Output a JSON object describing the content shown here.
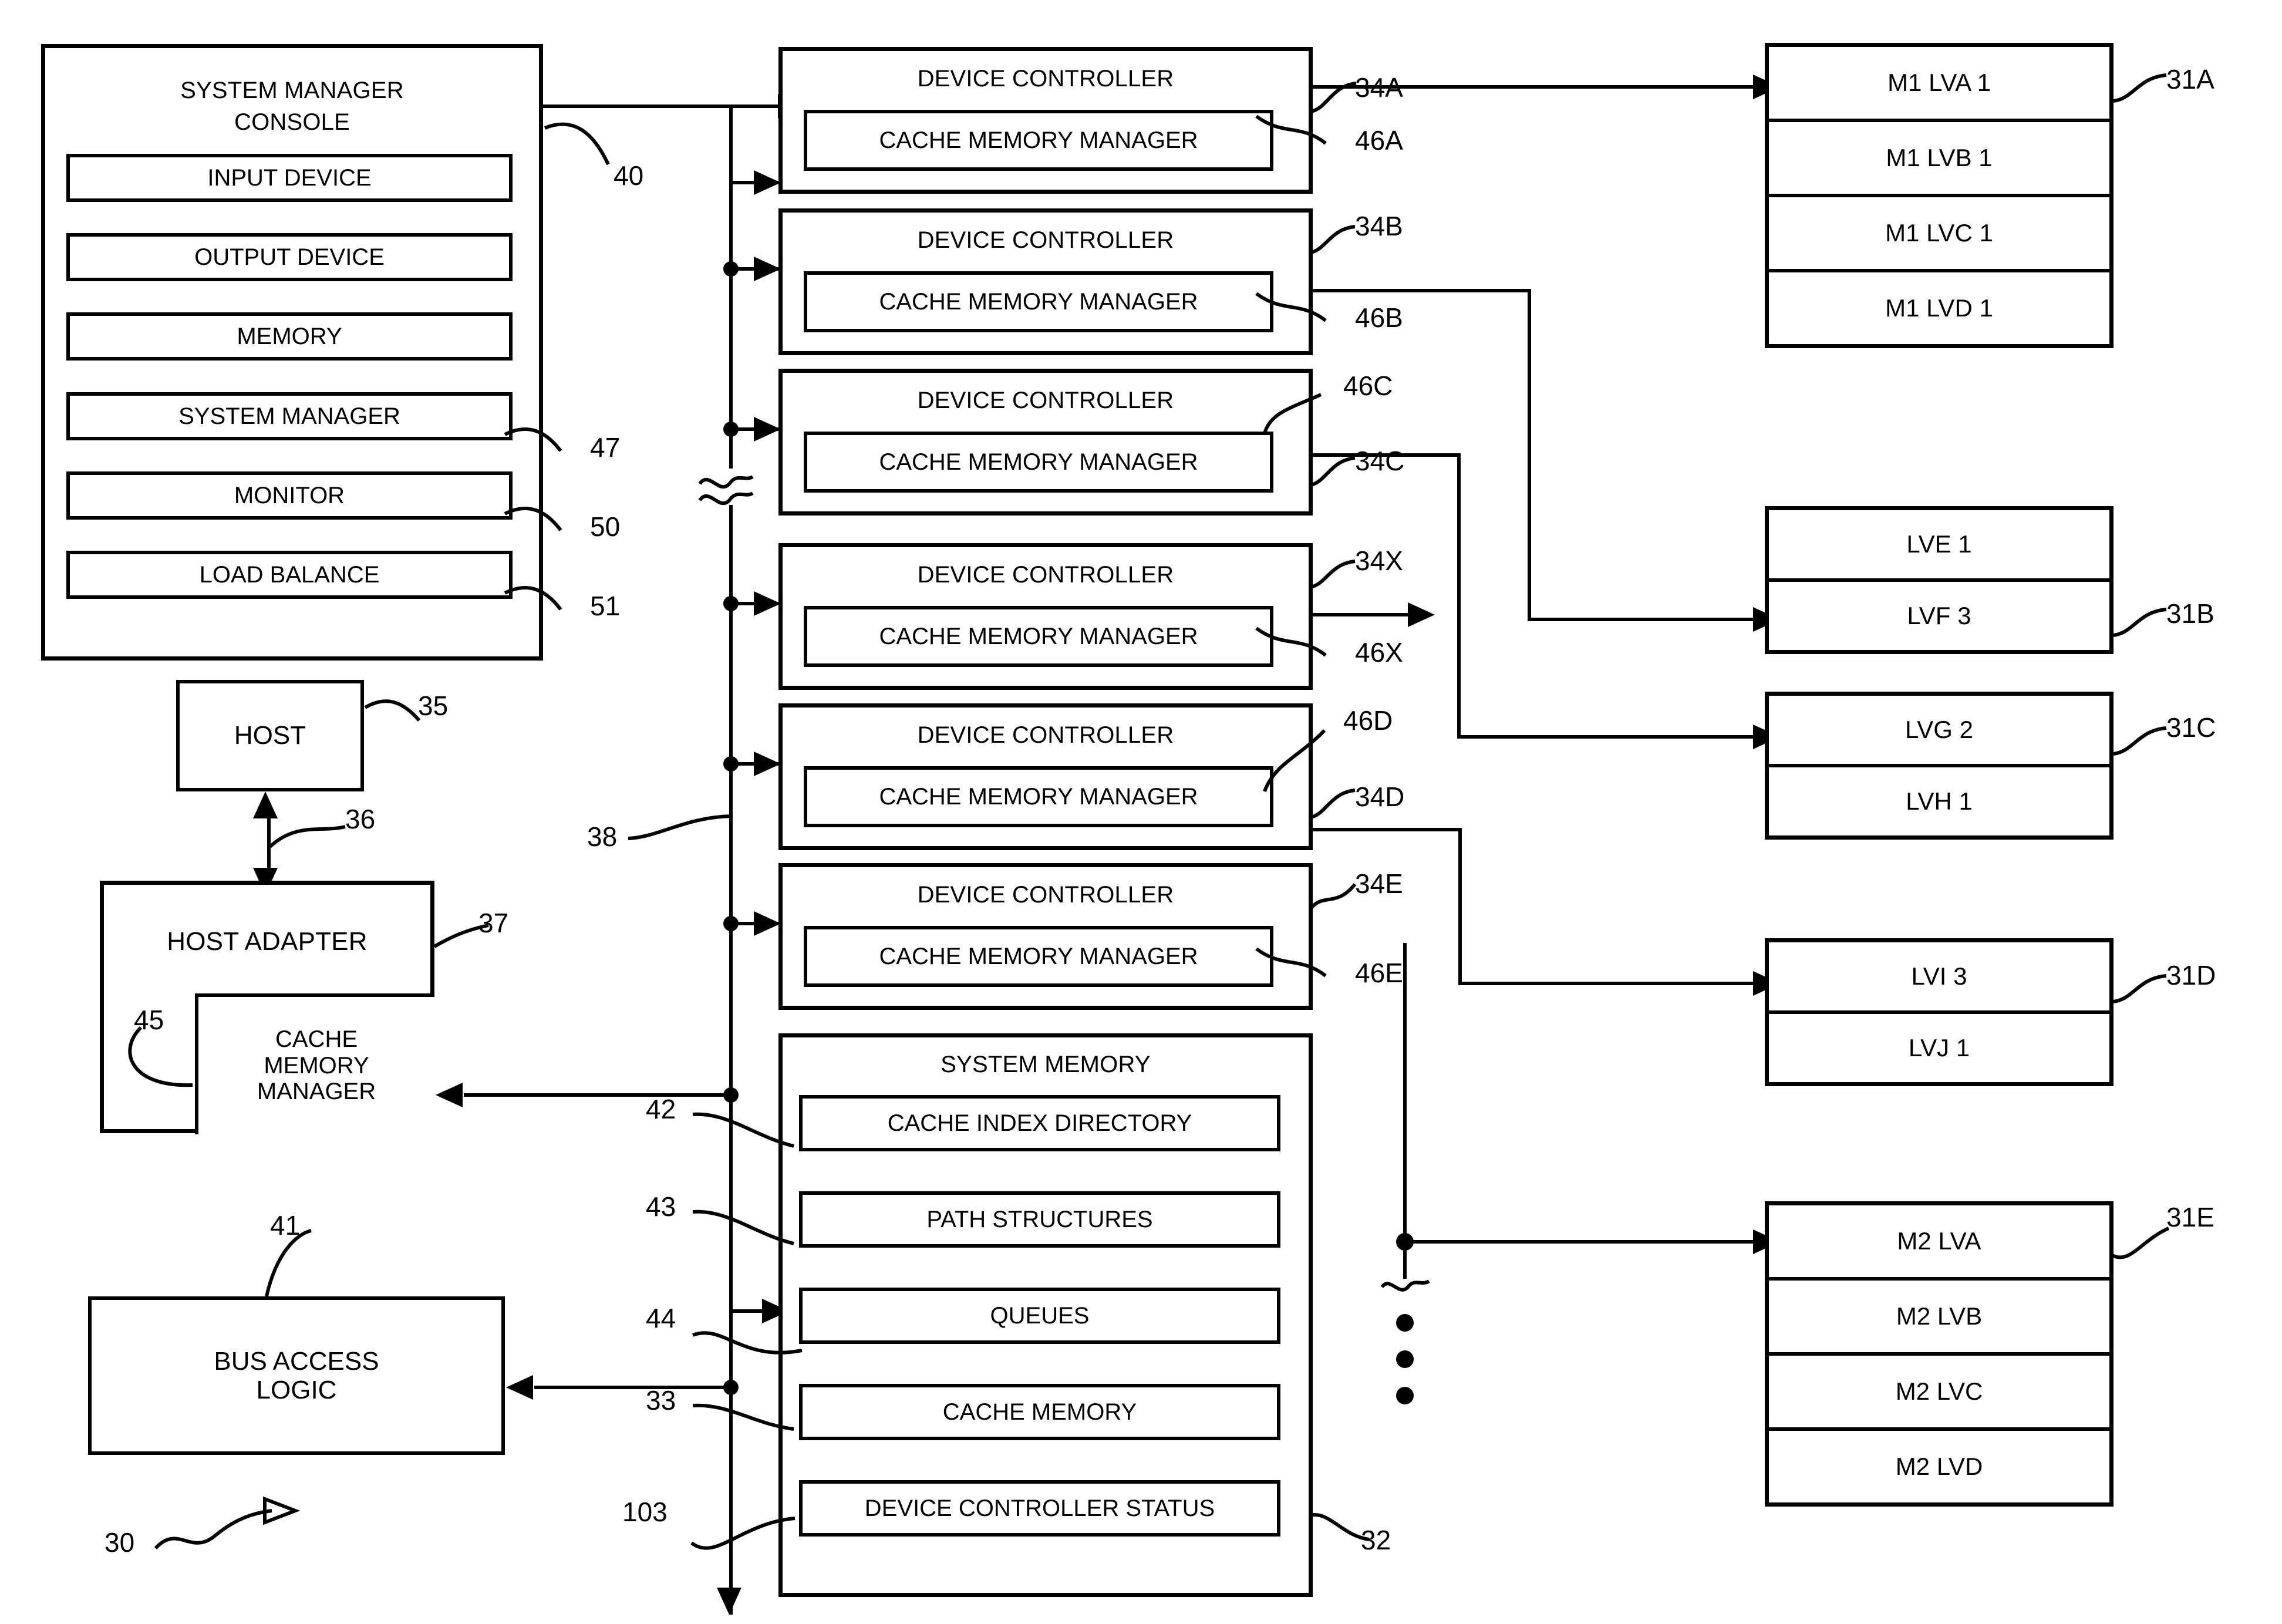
{
  "figure": {
    "label": "30",
    "bus_label": "38"
  },
  "console": {
    "title_line1": "SYSTEM MANAGER",
    "title_line2": "CONSOLE",
    "ref": "40",
    "items": [
      {
        "label": "INPUT DEVICE",
        "ref": ""
      },
      {
        "label": "OUTPUT DEVICE",
        "ref": ""
      },
      {
        "label": "MEMORY",
        "ref": ""
      },
      {
        "label": "SYSTEM MANAGER",
        "ref": "47"
      },
      {
        "label": "MONITOR",
        "ref": "50"
      },
      {
        "label": "LOAD BALANCE",
        "ref": "51"
      }
    ]
  },
  "host": {
    "label": "HOST",
    "ref": "35",
    "link_ref": "36"
  },
  "host_adapter": {
    "label": "HOST ADAPTER",
    "ref": "37",
    "cache_manager_line1": "CACHE",
    "cache_manager_line2": "MEMORY",
    "cache_manager_line3": "MANAGER",
    "cache_manager_ref": "45"
  },
  "bus_access_logic": {
    "line1": "BUS ACCESS",
    "line2": "LOGIC",
    "ref": "41"
  },
  "device_controllers": [
    {
      "title": "DEVICE CONTROLLER",
      "inner": "CACHE MEMORY MANAGER",
      "ref_ctrl": "34A",
      "ref_cmm": "46A"
    },
    {
      "title": "DEVICE CONTROLLER",
      "inner": "CACHE MEMORY MANAGER",
      "ref_ctrl": "34B",
      "ref_cmm": "46B"
    },
    {
      "title": "DEVICE CONTROLLER",
      "inner": "CACHE MEMORY MANAGER",
      "ref_ctrl": "34C",
      "ref_cmm": "46C"
    },
    {
      "title": "DEVICE CONTROLLER",
      "inner": "CACHE MEMORY MANAGER",
      "ref_ctrl": "34X",
      "ref_cmm": "46X"
    },
    {
      "title": "DEVICE CONTROLLER",
      "inner": "CACHE MEMORY MANAGER",
      "ref_ctrl": "34D",
      "ref_cmm": "46D"
    },
    {
      "title": "DEVICE CONTROLLER",
      "inner": "CACHE MEMORY MANAGER",
      "ref_ctrl": "34E",
      "ref_cmm": "46E"
    }
  ],
  "system_memory": {
    "title": "SYSTEM  MEMORY",
    "ref": "32",
    "items": [
      {
        "label": "CACHE INDEX DIRECTORY",
        "ref": "42"
      },
      {
        "label": "PATH STRUCTURES",
        "ref": "43"
      },
      {
        "label": "QUEUES",
        "ref": "44"
      },
      {
        "label": "CACHE MEMORY",
        "ref": "33"
      },
      {
        "label": "DEVICE CONTROLLER STATUS",
        "ref": "103"
      }
    ]
  },
  "volume_groups": [
    {
      "ref": "31A",
      "cells": [
        "M1 LVA 1",
        "M1 LVB 1",
        "M1 LVC 1",
        "M1 LVD 1"
      ]
    },
    {
      "ref": "31B",
      "cells": [
        "LVE 1",
        "LVF 3"
      ]
    },
    {
      "ref": "31C",
      "cells": [
        "LVG 2",
        "LVH 1"
      ]
    },
    {
      "ref": "31D",
      "cells": [
        "LVI 3",
        "LVJ 1"
      ]
    },
    {
      "ref": "31E",
      "cells": [
        "M2 LVA",
        "M2 LVB",
        "M2 LVC",
        "M2 LVD"
      ]
    }
  ]
}
